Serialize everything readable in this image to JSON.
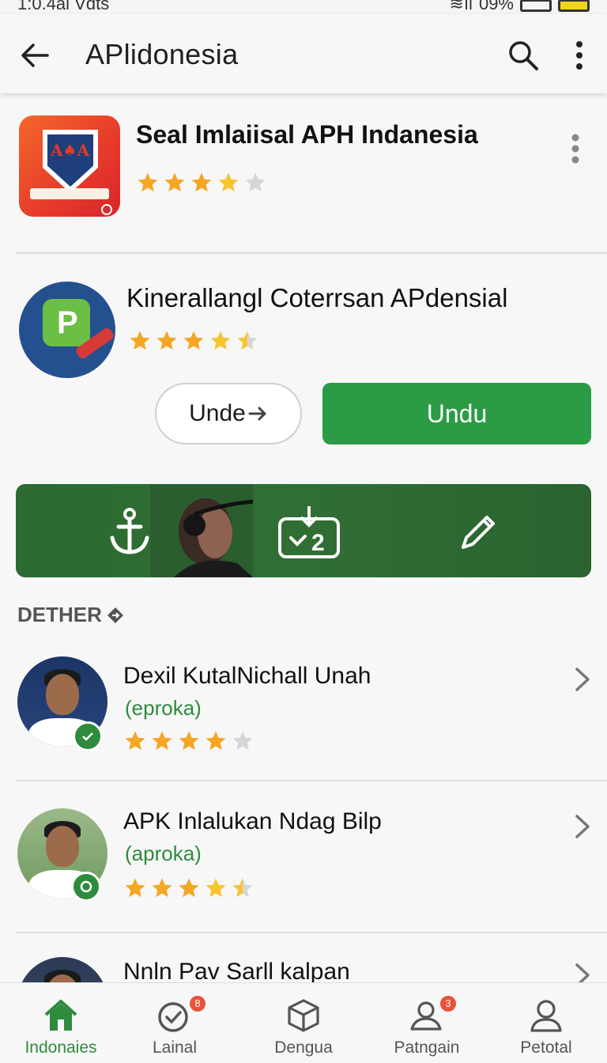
{
  "status_bar": {
    "time": "1:0.4al Vdts",
    "battery": "09%"
  },
  "app_bar": {
    "title": "APlidonesia",
    "back_icon": "arrow-left-icon",
    "search_icon": "search-icon",
    "more_icon": "more-vert-icon"
  },
  "featured": [
    {
      "name": "Seal Imlaiisal APH Indanesia",
      "rating": 4
    },
    {
      "name": "Kinerallangl Coterrsan APdensial",
      "rating": 4,
      "secondary_button": "Unde",
      "primary_button": "Undu"
    }
  ],
  "section_header": "DETHER",
  "list": [
    {
      "title": "Dexil KutalNichall Unah",
      "subtitle": "(eproka)",
      "rating": 4
    },
    {
      "title": "APK Inlalukan Ndag Bilp",
      "subtitle": "(aproka)",
      "rating": 4
    },
    {
      "title": "Nnln Pav Sarll kalpan"
    }
  ],
  "bottom_nav": [
    {
      "label": "Indonaies",
      "icon": "home-icon",
      "active": true
    },
    {
      "label": "Lainal",
      "icon": "check-circle-icon",
      "badge": "8"
    },
    {
      "label": "Dengua",
      "icon": "box-icon"
    },
    {
      "label": "Patngain",
      "icon": "people-icon",
      "badge": "3"
    },
    {
      "label": "Petotal",
      "icon": "person-icon"
    }
  ],
  "colors": {
    "accent": "#2b9c45",
    "banner": "#2c6a31",
    "star": "#f5a623",
    "badge": "#e9533a"
  }
}
